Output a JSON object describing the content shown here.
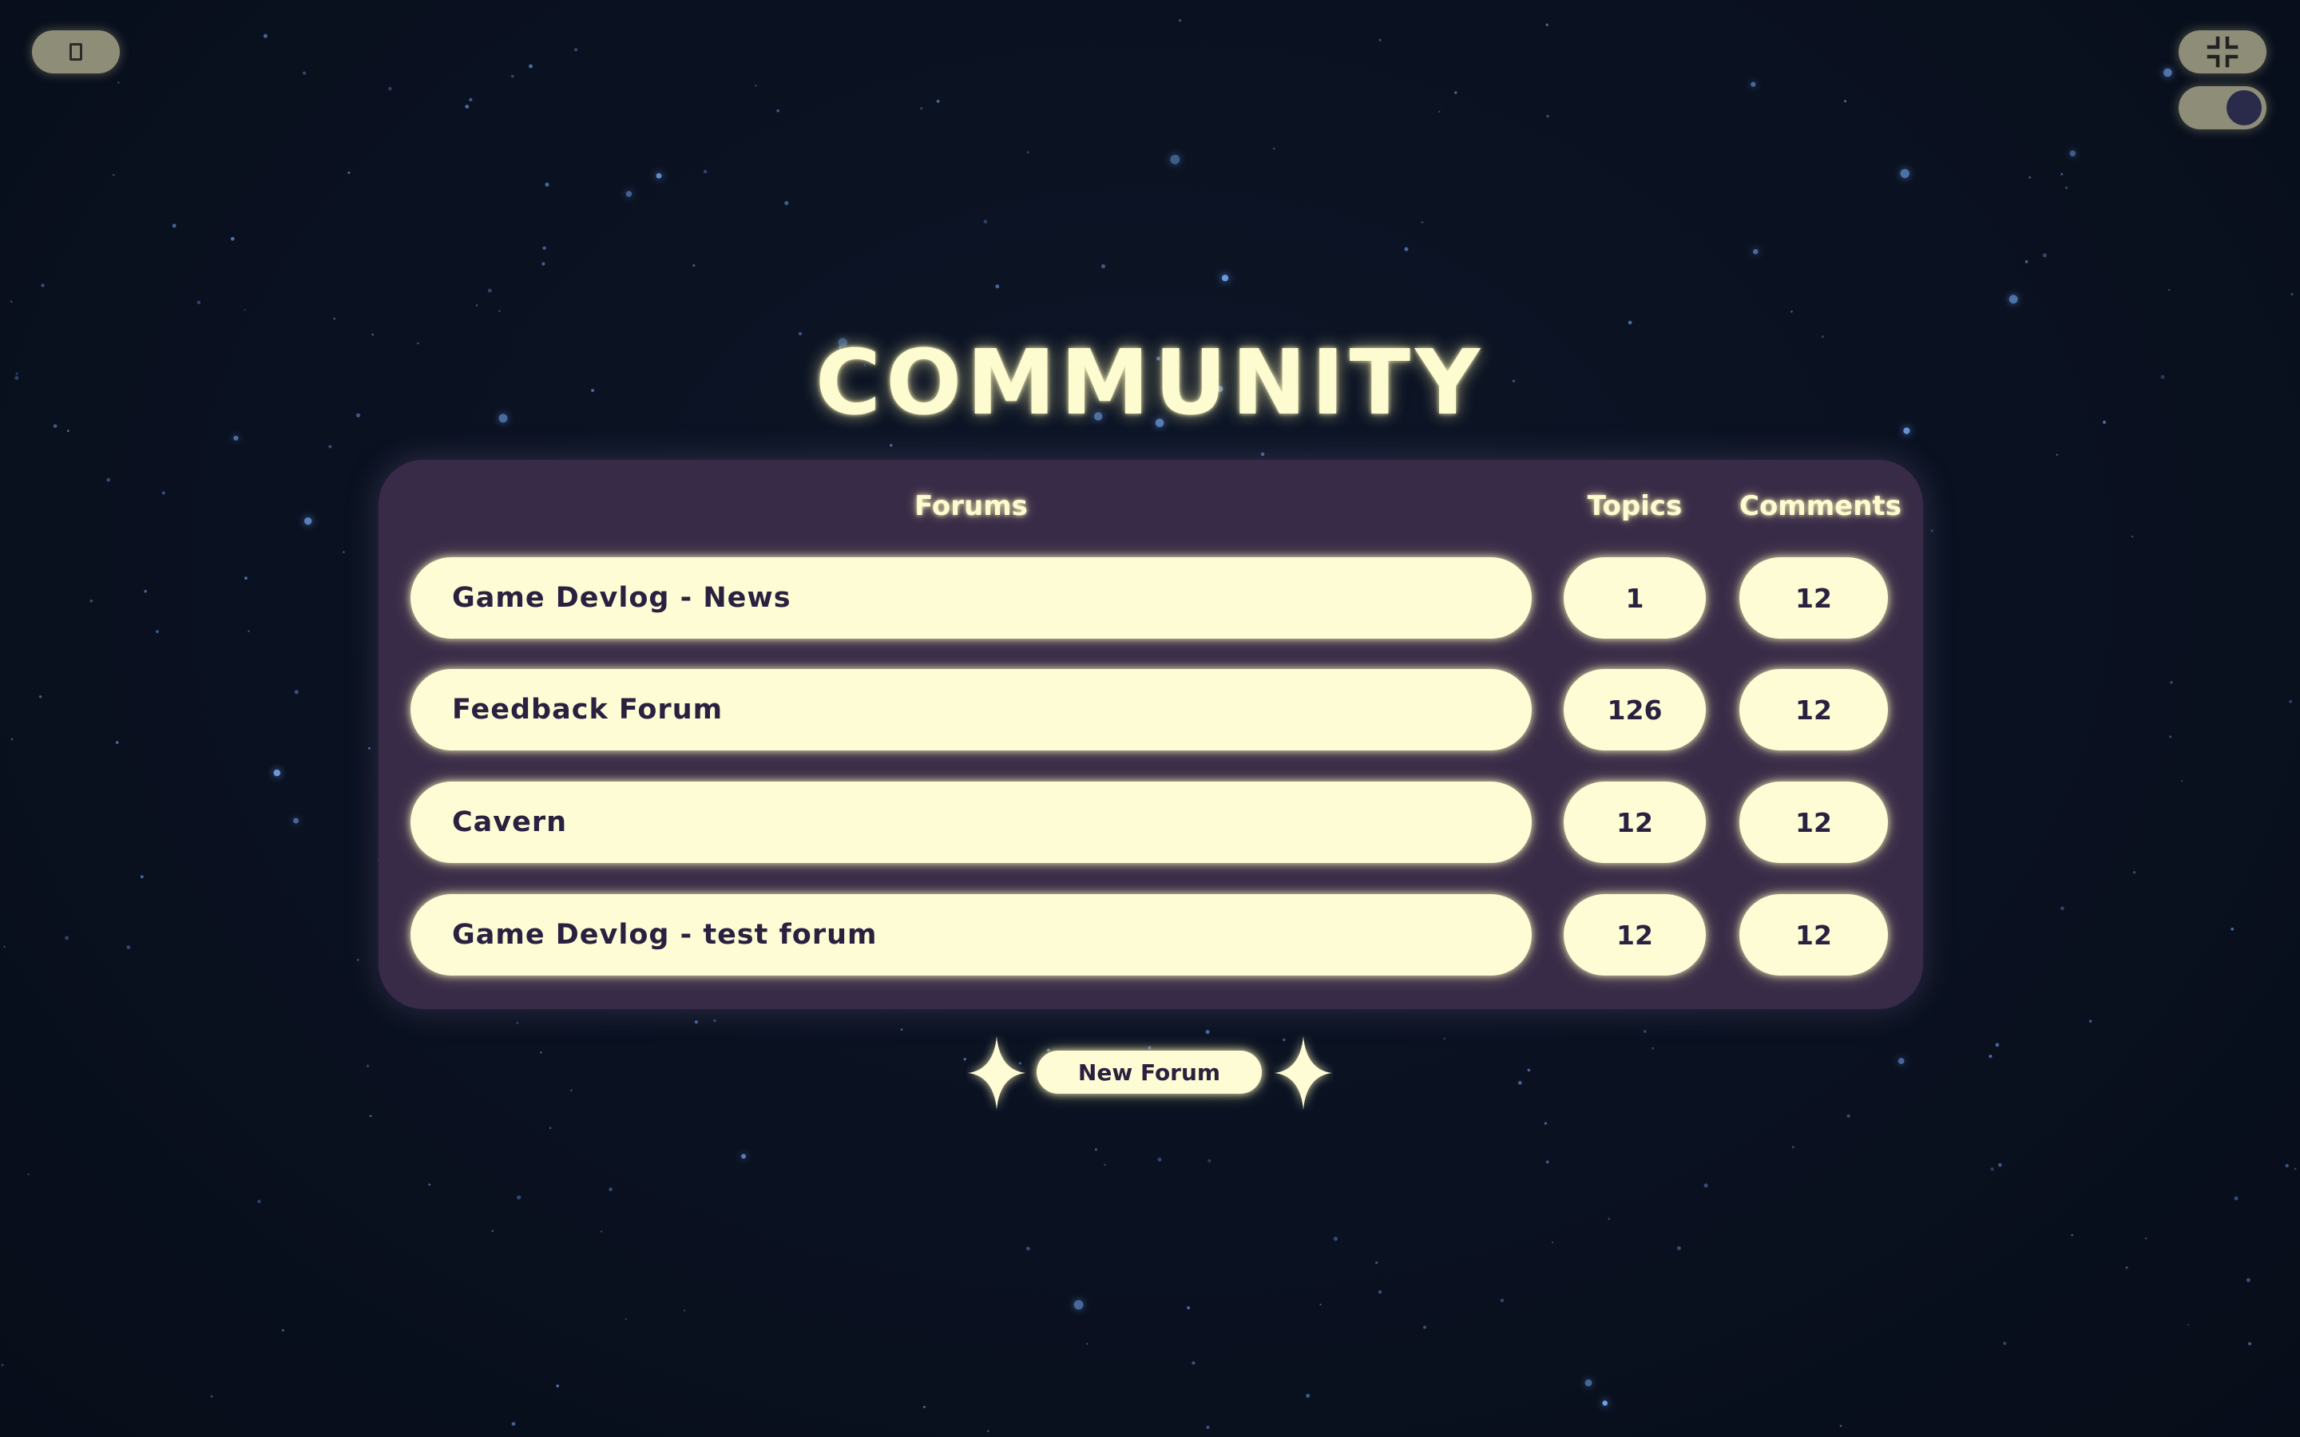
{
  "header": {
    "menu_icon": "page-icon",
    "collapse_icon": "collapse-arrows-icon",
    "theme_toggle_icon": "moon-toggle-icon"
  },
  "page": {
    "title": "COMMUNITY"
  },
  "table": {
    "headers": {
      "forums": "Forums",
      "topics": "Topics",
      "comments": "Comments"
    },
    "rows": [
      {
        "name": "Game Devlog - News",
        "topics": "1",
        "comments": "12"
      },
      {
        "name": "Feedback Forum",
        "topics": "126",
        "comments": "12"
      },
      {
        "name": "Cavern",
        "topics": "12",
        "comments": "12"
      },
      {
        "name": "Game Devlog - test forum",
        "topics": "12",
        "comments": "12"
      }
    ]
  },
  "actions": {
    "new_forum_label": "New Forum",
    "sparkle_icon": "sparkle-icon"
  },
  "colors": {
    "background": "#0a1120",
    "panel": "#382b48",
    "pill": "#fdfcd4",
    "glow_text": "#fdfbd0",
    "pill_text": "#2a2140",
    "corner_button": "#8d8d78"
  }
}
